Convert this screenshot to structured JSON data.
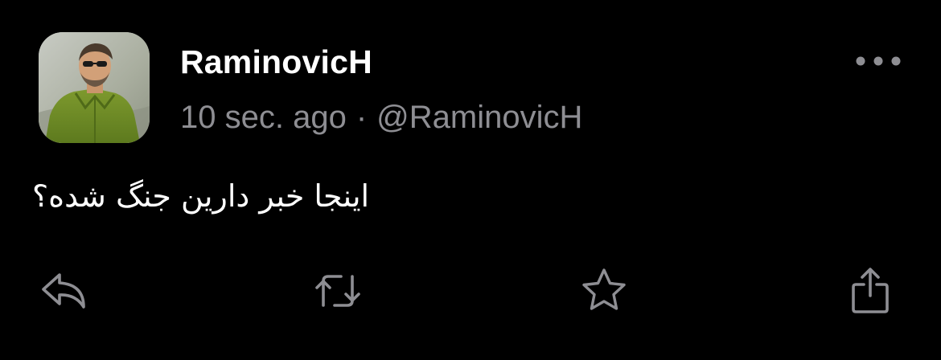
{
  "post": {
    "display_name": "RaminovicH",
    "timestamp": "10 sec. ago",
    "separator": "·",
    "handle": "@RaminovicH",
    "text": "اینجا خبر دارین جنگ شده؟"
  },
  "icons": {
    "more": "more-horizontal-icon",
    "reply": "reply-arrow-icon",
    "repost": "repost-icon",
    "like": "star-icon",
    "share": "share-icon"
  },
  "colors": {
    "background": "#000000",
    "primary_text": "#ffffff",
    "secondary_text": "#8e8e93",
    "icon": "#8e8e93"
  }
}
